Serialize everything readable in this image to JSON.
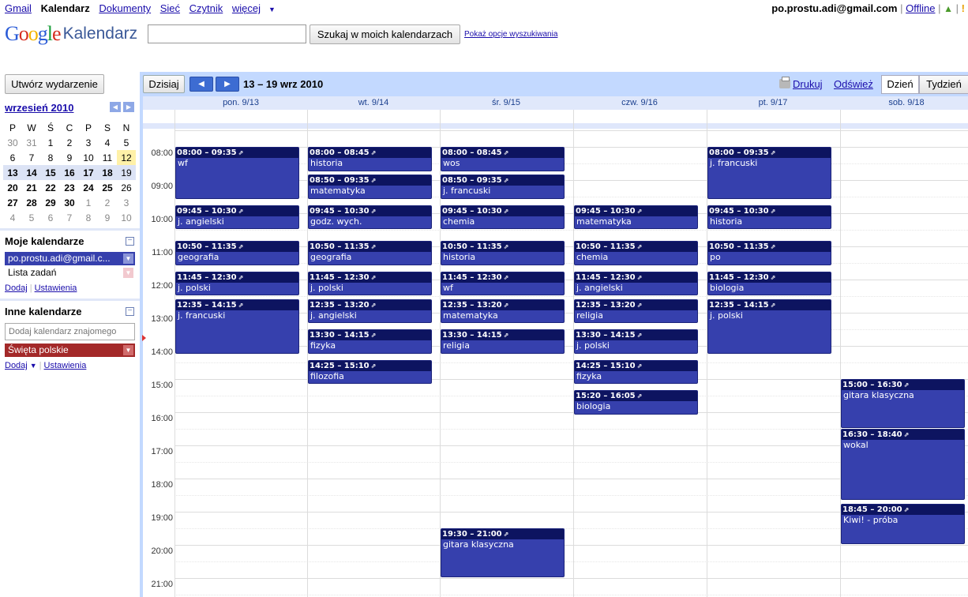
{
  "topbar": {
    "links": [
      "Gmail",
      "Kalendarz",
      "Dokumenty",
      "Sieć",
      "Czytnik",
      "więcej"
    ],
    "current": "Kalendarz",
    "email": "po.prostu.adi@gmail.com",
    "offline": "Offline",
    "sep": "|"
  },
  "header": {
    "logo_google": "Google",
    "logo_product": "Kalendarz",
    "search_button": "Szukaj w moich kalendarzach",
    "search_options": "Pokaż opcje wyszukiwania"
  },
  "sidebar": {
    "create_button": "Utwórz wydarzenie",
    "mini_month": "wrzesień 2010",
    "weekdays": [
      "P",
      "W",
      "Ś",
      "C",
      "P",
      "S",
      "N"
    ],
    "weeks": [
      [
        "30",
        "31",
        "1",
        "2",
        "3",
        "4",
        "5"
      ],
      [
        "6",
        "7",
        "8",
        "9",
        "10",
        "11",
        "12"
      ],
      [
        "13",
        "14",
        "15",
        "16",
        "17",
        "18",
        "19"
      ],
      [
        "20",
        "21",
        "22",
        "23",
        "24",
        "25",
        "26"
      ],
      [
        "27",
        "28",
        "29",
        "30",
        "1",
        "2",
        "3"
      ],
      [
        "4",
        "5",
        "6",
        "7",
        "8",
        "9",
        "10"
      ]
    ],
    "my_calendars_title": "Moje kalendarze",
    "my_calendars": [
      {
        "label": "po.prostu.adi@gmail.c...",
        "color": "#3640ad"
      },
      {
        "label": "Lista zadań",
        "color": "#f2c9cf"
      }
    ],
    "my_links": {
      "add": "Dodaj",
      "settings": "Ustawienia"
    },
    "other_calendars_title": "Inne kalendarze",
    "friend_placeholder": "Dodaj kalendarz znajomego",
    "other_calendars": [
      {
        "label": "Święta polskie",
        "color": "#a32929"
      }
    ],
    "other_links": {
      "add": "Dodaj",
      "settings": "Ustawienia"
    }
  },
  "toolbar": {
    "today": "Dzisiaj",
    "date_range": "13 – 19 wrz 2010",
    "print": "Drukuj",
    "refresh": "Odśwież",
    "views": [
      "Dzień",
      "Tydzień"
    ],
    "active_view": "Dzień"
  },
  "grid": {
    "days": [
      "pon. 9/13",
      "wt. 9/14",
      "śr. 9/15",
      "czw. 9/16",
      "pt. 9/17",
      "sob. 9/18"
    ],
    "hours": [
      "08:00",
      "09:00",
      "10:00",
      "11:00",
      "12:00",
      "13:00",
      "14:00",
      "15:00",
      "16:00",
      "17:00",
      "18:00",
      "19:00",
      "20:00",
      "21:00"
    ],
    "events": [
      {
        "day": 0,
        "time": "08:00 – 09:35",
        "title": "wf"
      },
      {
        "day": 0,
        "time": "09:45 – 10:30",
        "title": "j. angielski"
      },
      {
        "day": 0,
        "time": "10:50 – 11:35",
        "title": "geografia"
      },
      {
        "day": 0,
        "time": "11:45 – 12:30",
        "title": "j. polski"
      },
      {
        "day": 0,
        "time": "12:35 – 14:15",
        "title": "j. francuski"
      },
      {
        "day": 1,
        "time": "08:00 – 08:45",
        "title": "historia"
      },
      {
        "day": 1,
        "time": "08:50 – 09:35",
        "title": "matematyka"
      },
      {
        "day": 1,
        "time": "09:45 – 10:30",
        "title": "godz. wych."
      },
      {
        "day": 1,
        "time": "10:50 – 11:35",
        "title": "geografia"
      },
      {
        "day": 1,
        "time": "11:45 – 12:30",
        "title": "j. polski"
      },
      {
        "day": 1,
        "time": "12:35 – 13:20",
        "title": "j. angielski"
      },
      {
        "day": 1,
        "time": "13:30 – 14:15",
        "title": "fizyka"
      },
      {
        "day": 1,
        "time": "14:25 – 15:10",
        "title": "filozofia"
      },
      {
        "day": 2,
        "time": "08:00 – 08:45",
        "title": "wos"
      },
      {
        "day": 2,
        "time": "08:50 – 09:35",
        "title": "j. francuski"
      },
      {
        "day": 2,
        "time": "09:45 – 10:30",
        "title": "chemia"
      },
      {
        "day": 2,
        "time": "10:50 – 11:35",
        "title": "historia"
      },
      {
        "day": 2,
        "time": "11:45 – 12:30",
        "title": "wf"
      },
      {
        "day": 2,
        "time": "12:35 – 13:20",
        "title": "matematyka"
      },
      {
        "day": 2,
        "time": "13:30 – 14:15",
        "title": "religia"
      },
      {
        "day": 2,
        "time": "19:30 – 21:00",
        "title": "gitara klasyczna"
      },
      {
        "day": 3,
        "time": "09:45 – 10:30",
        "title": "matematyka"
      },
      {
        "day": 3,
        "time": "10:50 – 11:35",
        "title": "chemia"
      },
      {
        "day": 3,
        "time": "11:45 – 12:30",
        "title": "j. angielski"
      },
      {
        "day": 3,
        "time": "12:35 – 13:20",
        "title": "religia"
      },
      {
        "day": 3,
        "time": "13:30 – 14:15",
        "title": "j. polski"
      },
      {
        "day": 3,
        "time": "14:25 – 15:10",
        "title": "fizyka"
      },
      {
        "day": 3,
        "time": "15:20 – 16:05",
        "title": "biologia"
      },
      {
        "day": 4,
        "time": "08:00 – 09:35",
        "title": "j. francuski"
      },
      {
        "day": 4,
        "time": "09:45 – 10:30",
        "title": "historia"
      },
      {
        "day": 4,
        "time": "10:50 – 11:35",
        "title": "po"
      },
      {
        "day": 4,
        "time": "11:45 – 12:30",
        "title": "biologia"
      },
      {
        "day": 4,
        "time": "12:35 – 14:15",
        "title": "j. polski"
      },
      {
        "day": 5,
        "time": "15:00 – 16:30",
        "title": "gitara klasyczna"
      },
      {
        "day": 5,
        "time": "16:30 – 18:40",
        "title": "wokal"
      },
      {
        "day": 5,
        "time": "18:45 – 20:00",
        "title": "Kiwi! - próba"
      }
    ]
  }
}
